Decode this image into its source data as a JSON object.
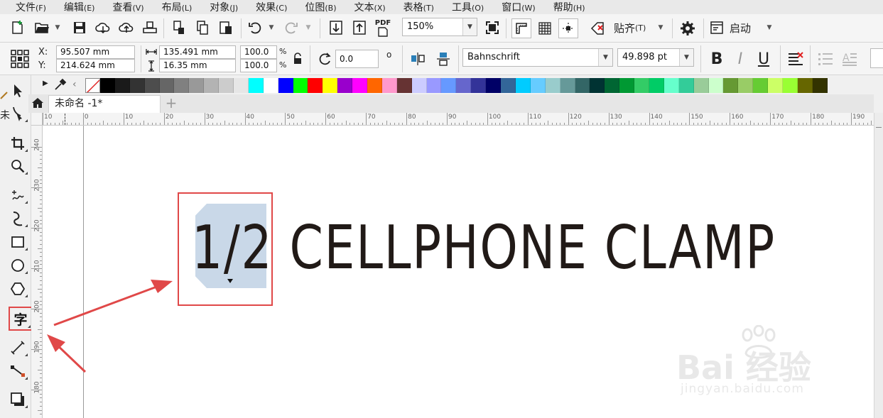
{
  "menu": [
    {
      "label": "文件",
      "accel": "(F)"
    },
    {
      "label": "编辑",
      "accel": "(E)"
    },
    {
      "label": "查看",
      "accel": "(V)"
    },
    {
      "label": "布局",
      "accel": "(L)"
    },
    {
      "label": "对象",
      "accel": "(J)"
    },
    {
      "label": "效果",
      "accel": "(C)"
    },
    {
      "label": "位图",
      "accel": "(B)"
    },
    {
      "label": "文本",
      "accel": "(X)"
    },
    {
      "label": "表格",
      "accel": "(T)"
    },
    {
      "label": "工具",
      "accel": "(O)"
    },
    {
      "label": "窗口",
      "accel": "(W)"
    },
    {
      "label": "帮助",
      "accel": "(H)"
    }
  ],
  "standard_toolbar": {
    "zoom": "150%",
    "pdf_label": "PDF",
    "snap_label": "贴齐",
    "snap_accel": "(T)",
    "launch_label": "启动"
  },
  "property_bar": {
    "x_label": "X:",
    "x_value": "95.507 mm",
    "y_label": "Y:",
    "y_value": "214.624 mm",
    "width_value": "135.491 mm",
    "height_value": "16.35 mm",
    "scale_x": "100.0",
    "scale_y": "100.0",
    "percent": "%",
    "rotation": "0.0",
    "degree": "o",
    "font_name": "Bahnschrift",
    "font_size": "49.898 pt",
    "bold": "B",
    "italic": "I",
    "underline": "U"
  },
  "palette_colors": [
    "#000000",
    "#1a1a1a",
    "#333333",
    "#4d4d4d",
    "#666666",
    "#808080",
    "#999999",
    "#b3b3b3",
    "#cccccc",
    "#e6e6e6",
    "#00ffff",
    "#ffffff",
    "#0000ff",
    "#00ff00",
    "#ff0000",
    "#ffff00",
    "#9900cc",
    "#ff00ff",
    "#ff6600",
    "#ff99cc",
    "#663333",
    "#ccccff",
    "#9999ff",
    "#6699ff",
    "#6666cc",
    "#333399",
    "#000066",
    "#336699",
    "#00ccff",
    "#66ccff",
    "#99cccc",
    "#669999",
    "#336666",
    "#003333",
    "#006633",
    "#009933",
    "#33cc66",
    "#00cc66",
    "#66ffcc",
    "#33cc99",
    "#99cc99",
    "#ccffcc",
    "#669933",
    "#99cc66",
    "#66cc33",
    "#ccff66",
    "#99ff33",
    "#666600",
    "#333300"
  ],
  "tab": {
    "doc_name": "未命名 -1*",
    "add": "+"
  },
  "ruler": {
    "h_labels": [
      "10",
      "0",
      "10",
      "20",
      "30",
      "40",
      "50",
      "60",
      "70",
      "80",
      "90",
      "100",
      "110",
      "120",
      "130",
      "140",
      "150",
      "160",
      "170",
      "180",
      "190"
    ],
    "v_labels": [
      "240",
      "230",
      "220",
      "210",
      "200",
      "190",
      "180"
    ]
  },
  "canvas": {
    "selected_text": "1/2",
    "rest_text": " CELLPHONE CLAMP"
  },
  "toolbox_text_tool": "字",
  "colors": {
    "accent_red": "#e04848",
    "selection": "#c9d8e8",
    "text": "#211a17"
  },
  "watermark": {
    "main": "Bai 经验",
    "sub": "jingyan.baidu.com"
  }
}
